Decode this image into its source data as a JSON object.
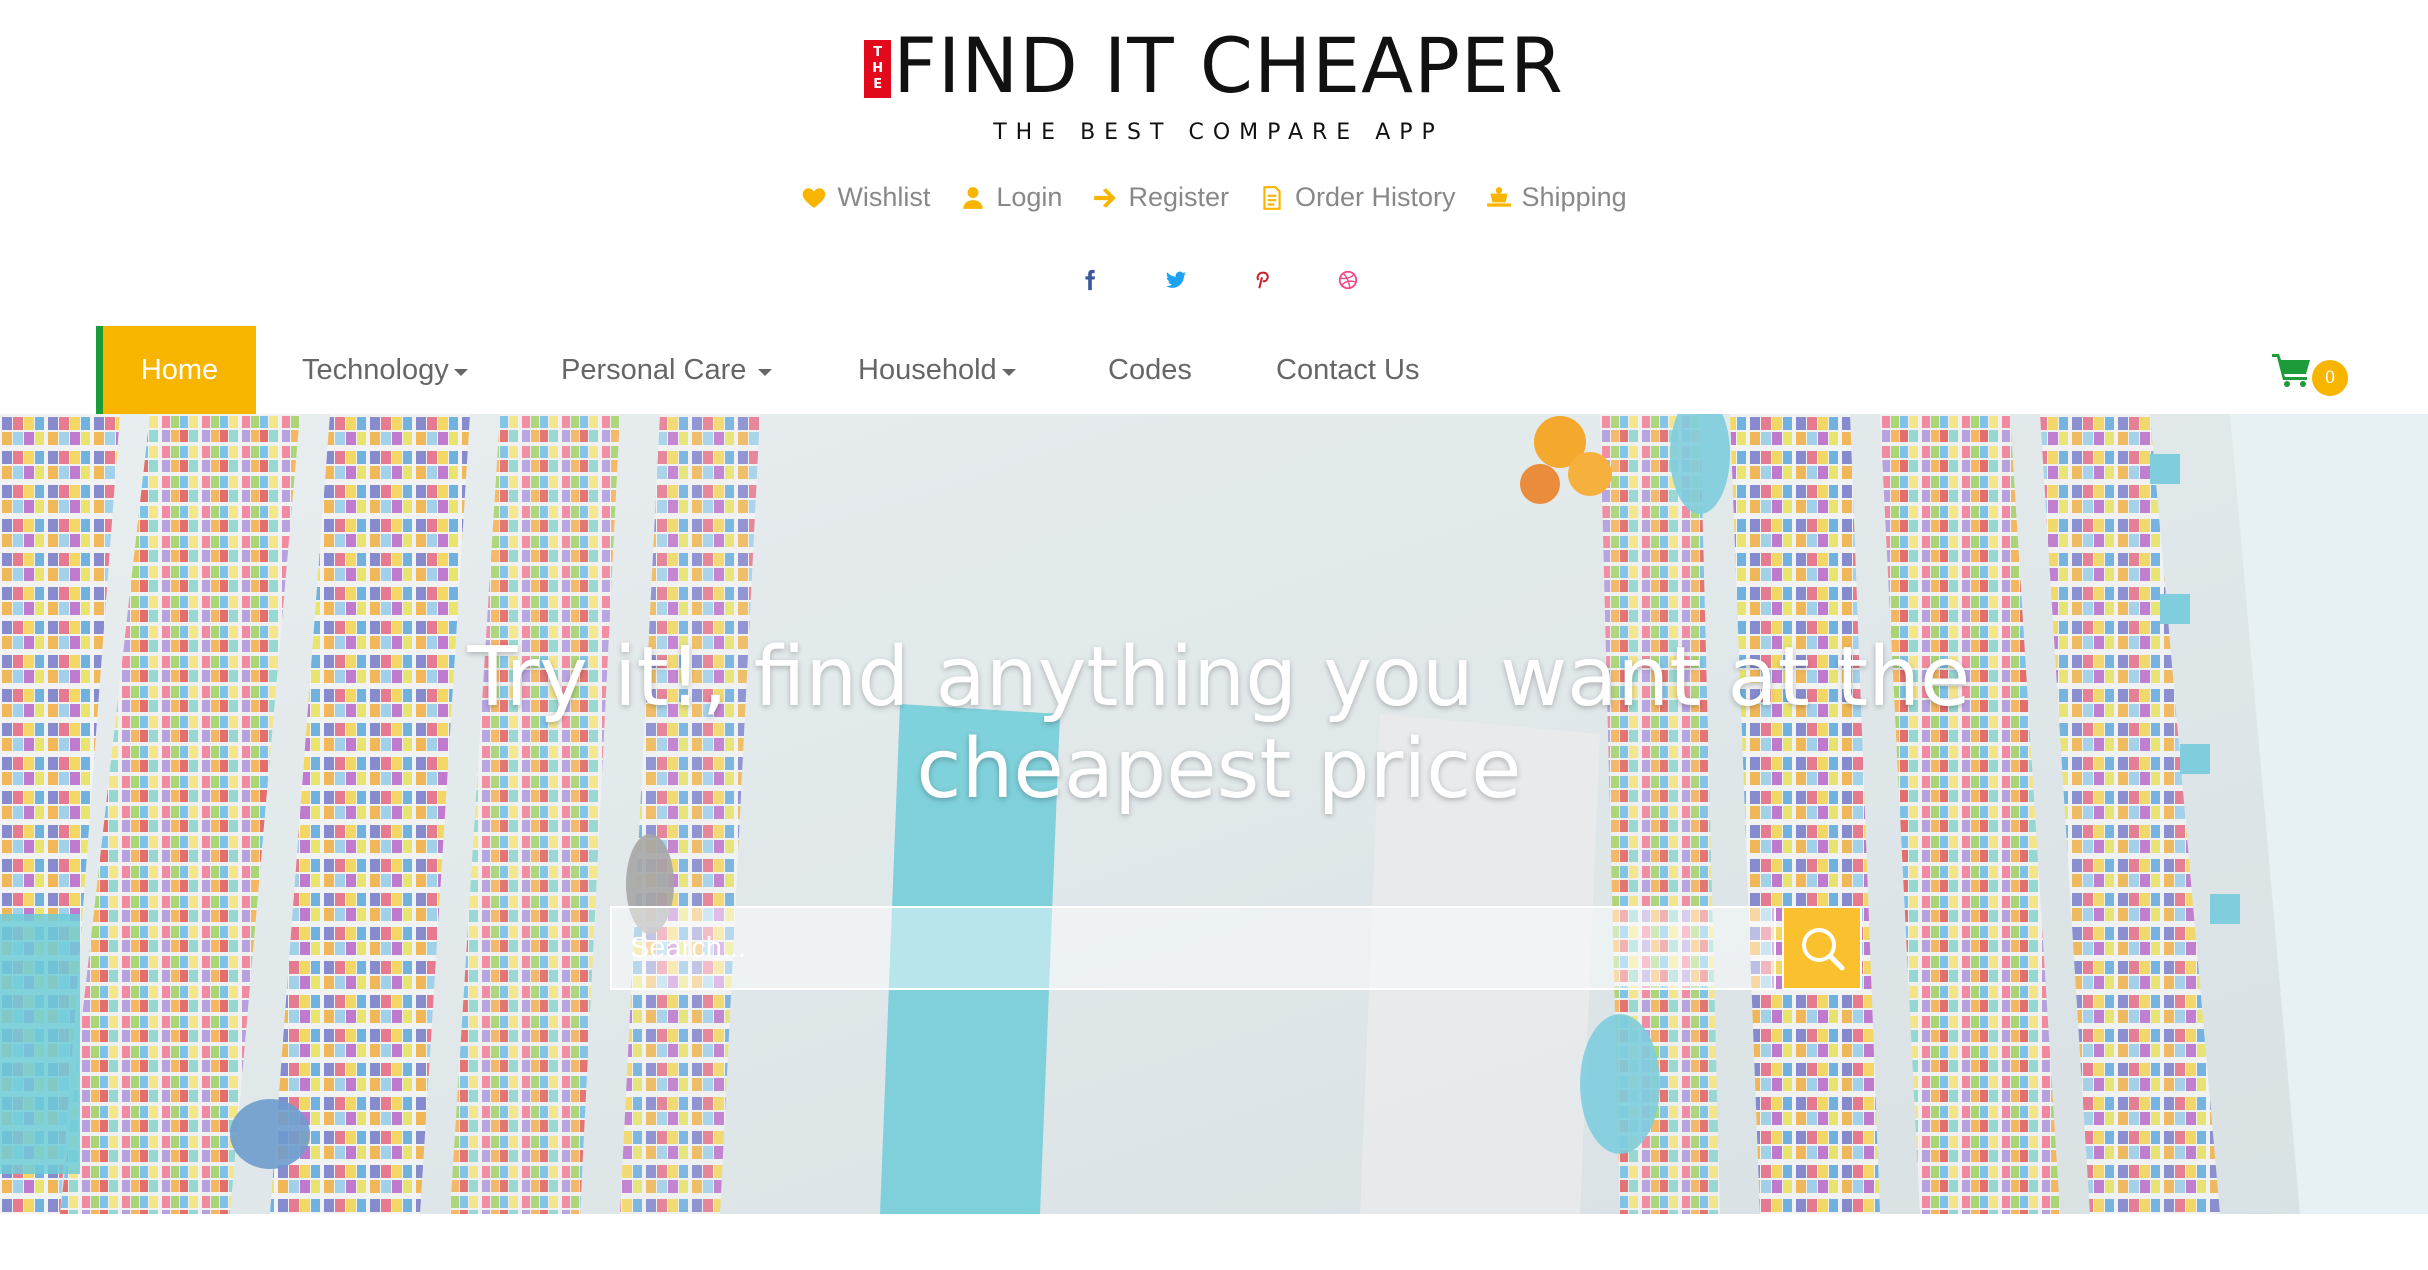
{
  "logo": {
    "prefix": "THE",
    "title": "FIND IT CHEAPER",
    "tagline": "THE BEST COMPARE APP"
  },
  "top_links": [
    {
      "label": "Wishlist",
      "icon": "heart-icon"
    },
    {
      "label": "Login",
      "icon": "user-icon"
    },
    {
      "label": "Register",
      "icon": "arrow-right-icon"
    },
    {
      "label": "Order History",
      "icon": "document-icon"
    },
    {
      "label": "Shipping",
      "icon": "truck-icon"
    }
  ],
  "social": [
    {
      "name": "facebook-icon",
      "color": "#3b5998"
    },
    {
      "name": "twitter-icon",
      "color": "#1da1f2"
    },
    {
      "name": "pinterest-icon",
      "color": "#cb2027"
    },
    {
      "name": "dribbble-icon",
      "color": "#ea4c89"
    }
  ],
  "nav": {
    "home": "Home",
    "items": [
      "Technology",
      "Personal Care",
      "Household",
      "Codes",
      "Contact Us"
    ],
    "cart_count": "0"
  },
  "hero": {
    "title_line1": "Try it!, find anything you want at the",
    "title_line2": "cheapest price",
    "search_placeholder": "Search..."
  },
  "colors": {
    "accent": "#f7b500",
    "home_border": "#1d9b3a",
    "cart": "#1d9b3a",
    "logo_red": "#e2091c"
  }
}
